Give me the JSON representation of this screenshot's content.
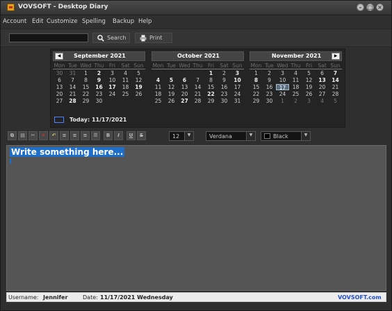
{
  "window": {
    "title": "VOVSOFT - Desktop Diary"
  },
  "menu": [
    "Account",
    "Edit",
    "Customize",
    "Spelling",
    "Backup",
    "Help"
  ],
  "toolbar": {
    "search_label": "Search",
    "print_label": "Print",
    "search_value": ""
  },
  "calendar": {
    "dow": [
      "Mon",
      "Tue",
      "Wed",
      "Thu",
      "Fri",
      "Sat",
      "Sun"
    ],
    "months": [
      {
        "title": "September 2021",
        "days": [
          [
            "30",
            "31",
            "1",
            "2",
            "3",
            "4",
            "5"
          ],
          [
            "6",
            "7",
            "8",
            "9",
            "10",
            "11",
            "12"
          ],
          [
            "13",
            "14",
            "15",
            "16",
            "17",
            "18",
            "19"
          ],
          [
            "20",
            "21",
            "22",
            "23",
            "24",
            "25",
            "26"
          ],
          [
            "27",
            "28",
            "29",
            "30",
            "",
            "",
            ""
          ],
          [
            "",
            "",
            "",
            "",
            "",
            "",
            ""
          ]
        ]
      },
      {
        "title": "October 2021",
        "days": [
          [
            "",
            "",
            "",
            "",
            "1",
            "2",
            "3"
          ],
          [
            "4",
            "5",
            "6",
            "7",
            "8",
            "9",
            "10"
          ],
          [
            "11",
            "12",
            "13",
            "14",
            "15",
            "16",
            "17"
          ],
          [
            "18",
            "19",
            "20",
            "21",
            "22",
            "23",
            "24"
          ],
          [
            "25",
            "26",
            "27",
            "28",
            "29",
            "30",
            "31"
          ],
          [
            "",
            "",
            "",
            "",
            "",
            "",
            ""
          ]
        ]
      },
      {
        "title": "November 2021",
        "days": [
          [
            "1",
            "2",
            "3",
            "4",
            "5",
            "6",
            "7"
          ],
          [
            "8",
            "9",
            "10",
            "11",
            "12",
            "13",
            "14"
          ],
          [
            "15",
            "16",
            "17",
            "18",
            "19",
            "20",
            "21"
          ],
          [
            "22",
            "23",
            "24",
            "25",
            "26",
            "27",
            "28"
          ],
          [
            "29",
            "30",
            "1",
            "2",
            "3",
            "4",
            "5"
          ],
          [
            "",
            "",
            "",
            "",
            "",
            "",
            ""
          ]
        ]
      }
    ],
    "selected_date": "17",
    "today_label": "Today: 11/17/2021"
  },
  "format": {
    "font_size": "12",
    "font_name": "Verdana",
    "color_name": "Black",
    "bold_label": "B",
    "italic_label": "I",
    "underline_label": "U",
    "strike_label": "S"
  },
  "editor": {
    "text": "Write something here..."
  },
  "status": {
    "username_label": "Username:",
    "username": "Jennifer",
    "date_label": "Date:",
    "date": "11/17/2021 Wednesday",
    "brand": "VOVSOFT.com"
  },
  "colors": {
    "accent": "#1f6fc9",
    "brand": "#1f4fd0",
    "today_border": "#4c84ff"
  }
}
